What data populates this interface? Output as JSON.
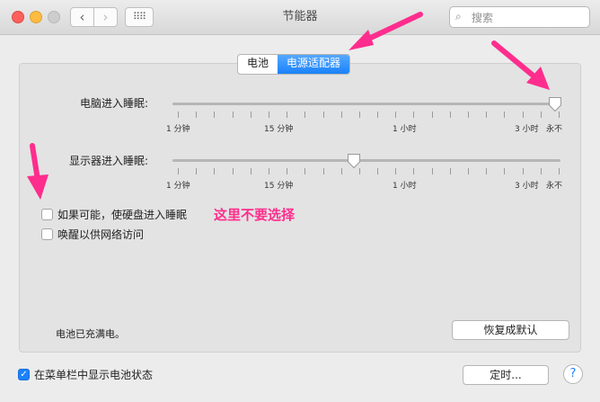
{
  "window": {
    "title": "节能器"
  },
  "search": {
    "placeholder": "搜索",
    "icon": "magnifier"
  },
  "tabs": [
    {
      "label": "电池",
      "active": false
    },
    {
      "label": "电源适配器",
      "active": true
    }
  ],
  "sliders": {
    "computer": {
      "label": "电脑进入睡眠:",
      "value_label": "永不"
    },
    "display": {
      "label": "显示器进入睡眠:",
      "value_label": "1 小时"
    }
  },
  "tick_labels": [
    "1 分钟",
    "15 分钟",
    "1 小时",
    "3 小时",
    "永不"
  ],
  "options": {
    "harddisk": {
      "label": "如果可能，使硬盘进入睡眠",
      "checked": false
    },
    "network": {
      "label": "唤醒以供网络访问",
      "checked": false
    }
  },
  "annotation": "这里不要选择",
  "status_text": "电池已充满电。",
  "restore_button": "恢复成默认",
  "menubar_option": {
    "label": "在菜单栏中显示电池状态",
    "checked": true
  },
  "schedule_button": "定时...",
  "help_label": "?",
  "colors": {
    "accent": "#1a82fb",
    "annotation": "#ff2d8d"
  }
}
